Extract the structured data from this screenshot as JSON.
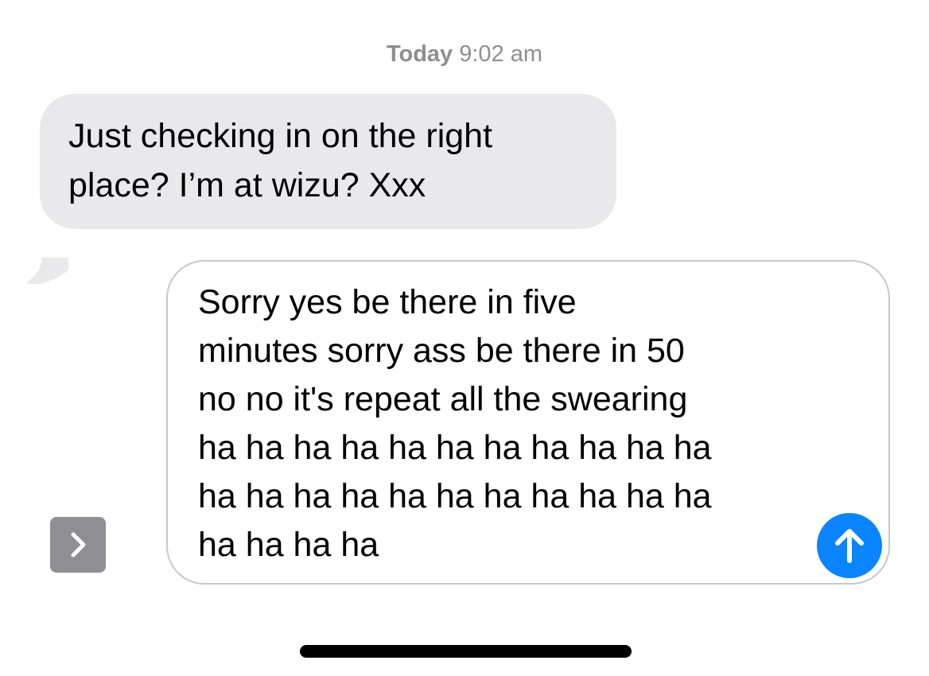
{
  "conversation": {
    "timestamp_day": "Today",
    "timestamp_time": "9:02 am",
    "incoming_message": "Just checking in on the right\nplace? I’m at wizu? Xxx"
  },
  "composer": {
    "draft_text": "Sorry yes be there in five\nminutes sorry ass be there in 50\nno no it's repeat all the swearing\nha ha ha ha ha ha ha ha ha ha ha\nha ha ha ha ha ha ha ha ha ha ha\nha ha ha ha",
    "send_icon": "arrow-up-icon",
    "expand_icon": "chevron-right-icon"
  },
  "colors": {
    "incoming_bubble": "#e9e9eb",
    "send_button": "#0a84ff",
    "expand_button": "#8e8e93",
    "timestamp_text": "#8e8e93",
    "composer_border": "#c7c7cc"
  }
}
